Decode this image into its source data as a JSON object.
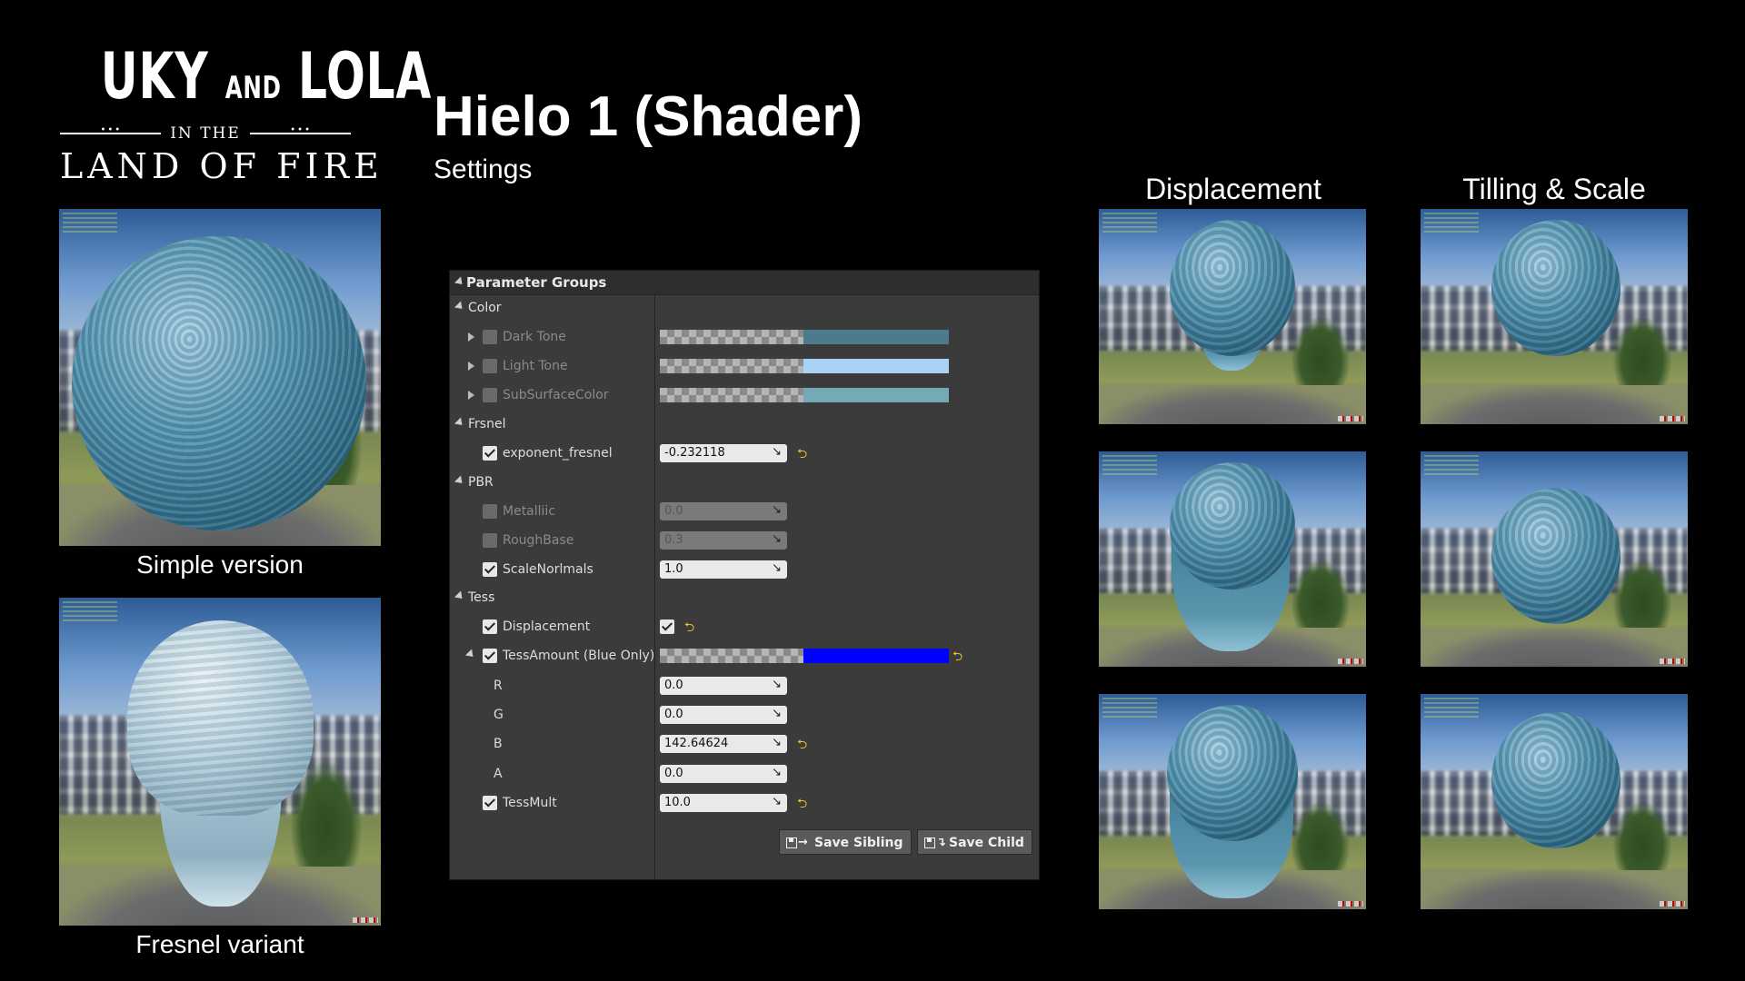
{
  "logo": {
    "line1": "UKY",
    "line1_and": "AND",
    "line1_end": "LOLA",
    "line2": "IN THE",
    "line3": "LAND OF FIRE"
  },
  "header": {
    "title": "Hielo 1 (Shader)",
    "subtitle": "Settings"
  },
  "captions": {
    "simple": "Simple version",
    "fresnel": "Fresnel variant",
    "displacement": "Displacement",
    "tilling": "Tilling & Scale"
  },
  "panel": {
    "header": "Parameter Groups",
    "groups": {
      "color": "Color",
      "frsnel": "Frsnel",
      "pbr": "PBR",
      "tess": "Tess"
    },
    "params": {
      "dark_tone": {
        "label": "Dark Tone",
        "color": "#4e7b8b"
      },
      "light_tone": {
        "label": "Light Tone",
        "color": "#a9d2f5"
      },
      "subsurface": {
        "label": "SubSurfaceColor",
        "color": "#73aab5"
      },
      "exponent_fresnel": {
        "label": "exponent_fresnel",
        "value": "-0.232118"
      },
      "metalliic": {
        "label": "Metalliic",
        "value": "0.0"
      },
      "roughbase": {
        "label": "RoughBase",
        "value": "0.3"
      },
      "scalenorlmals": {
        "label": "ScaleNorlmals",
        "value": "1.0"
      },
      "displacement": {
        "label": "Displacement"
      },
      "tessamount": {
        "label": "TessAmount (Blue Only)",
        "color": "#0000ff"
      },
      "r": {
        "label": "R",
        "value": "0.0"
      },
      "g": {
        "label": "G",
        "value": "0.0"
      },
      "b": {
        "label": "B",
        "value": "142.64624"
      },
      "a": {
        "label": "A",
        "value": "0.0"
      },
      "tessmult": {
        "label": "TessMult",
        "value": "10.0"
      }
    },
    "buttons": {
      "save_sibling": "Save Sibling",
      "save_child": "Save Child"
    }
  },
  "colors": {
    "background": "#000000",
    "panel": "#3b3b3b",
    "reset_arrow": "#e6c229"
  }
}
